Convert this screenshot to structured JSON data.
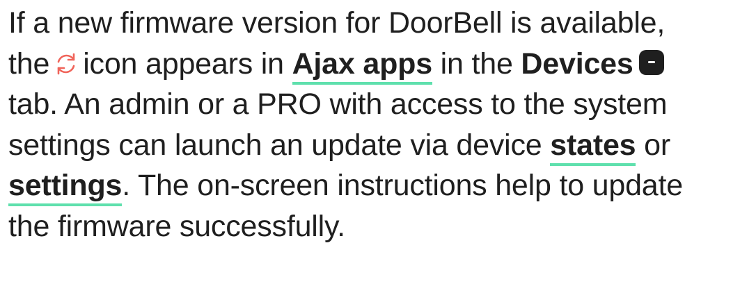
{
  "paragraph": {
    "line1": "If a new firmware version for DoorBell is available,",
    "line2_before_icon": "the",
    "line2_after_icon": "icon appears in",
    "link_ajax_apps": "Ajax apps",
    "line2_in_the": "in the",
    "devices_label": "Devices",
    "line3": "tab. An admin or a PRO with access to the system",
    "line4_before_link": "settings can launch an update via device",
    "link_states": "states",
    "line4_after_link": "or",
    "link_settings": "settings",
    "line5_after_link": ". The on-screen instructions help to update",
    "line6": "the firmware successfully."
  },
  "icons": {
    "refresh": "refresh-icon",
    "devices": "devices-tab-icon"
  },
  "colors": {
    "text": "#1f1f1f",
    "link_underline": "#5fe0ad",
    "refresh_icon": "#f0645a",
    "devices_icon": "#1f1f1f"
  }
}
